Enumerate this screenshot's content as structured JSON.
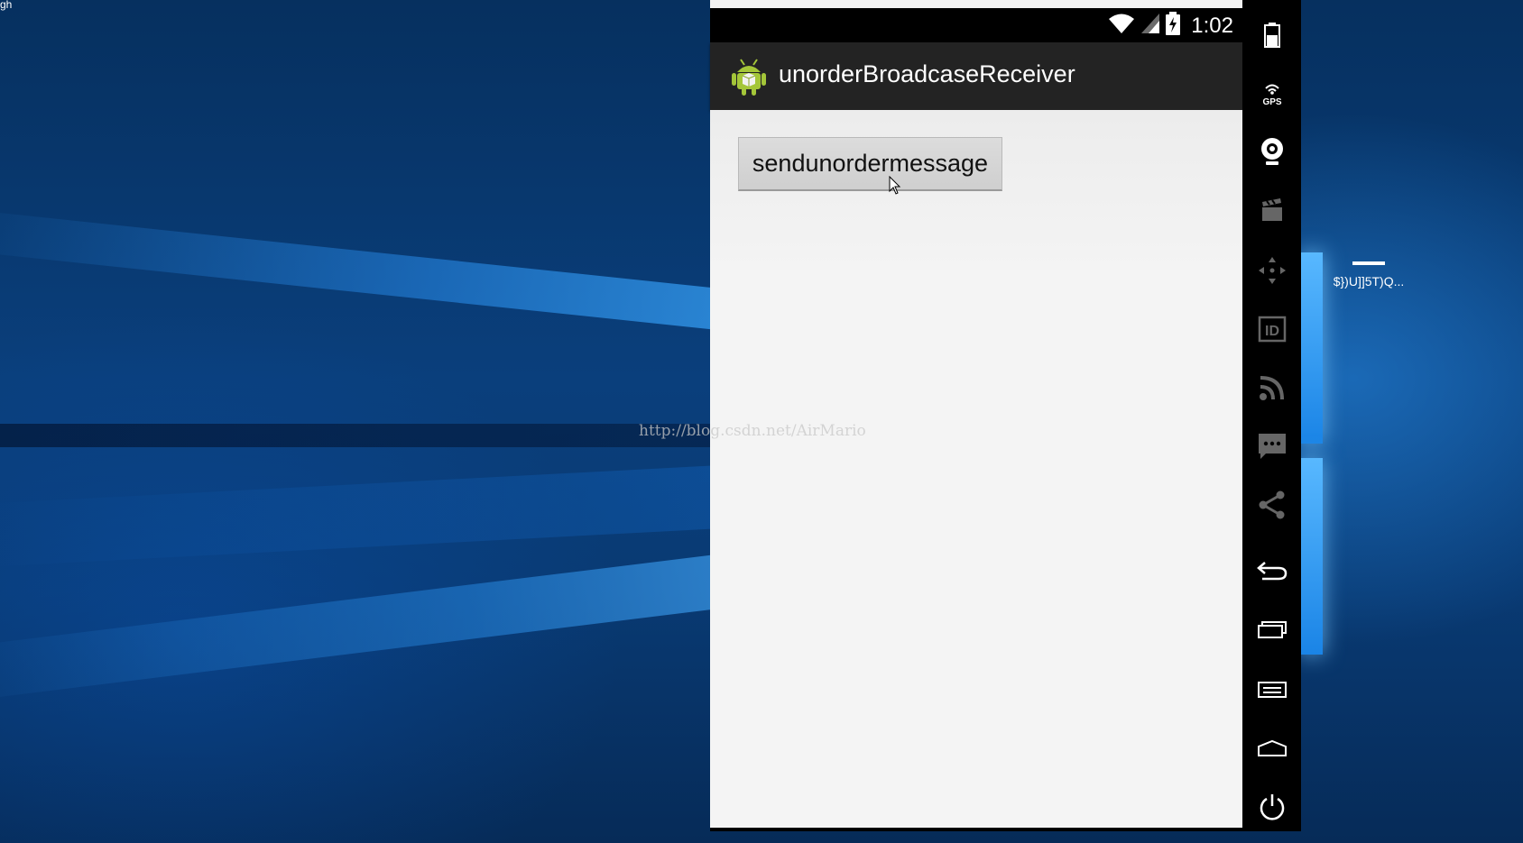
{
  "desktop": {
    "corner_text": "gh",
    "shortcut_label": "$})U]]5T)Q..."
  },
  "emulator": {
    "status": {
      "time": "1:02"
    },
    "app": {
      "title": "unorderBroadcaseReceiver"
    },
    "content": {
      "send_button_label": "sendunordermessage"
    },
    "watermark": "http://blog.csdn.net/AirMario",
    "sidebar": {
      "items": [
        {
          "icon": "battery-icon"
        },
        {
          "icon": "gps-icon",
          "label": "GPS"
        },
        {
          "icon": "camera-icon"
        },
        {
          "icon": "video-clapper-icon"
        },
        {
          "icon": "move-icon"
        },
        {
          "icon": "id-icon",
          "label": "ID"
        },
        {
          "icon": "rss-icon"
        },
        {
          "icon": "sms-icon"
        },
        {
          "icon": "share-icon"
        },
        {
          "icon": "back-icon"
        },
        {
          "icon": "recent-apps-icon"
        },
        {
          "icon": "menu-icon"
        },
        {
          "icon": "home-icon"
        },
        {
          "icon": "power-icon"
        }
      ]
    }
  }
}
